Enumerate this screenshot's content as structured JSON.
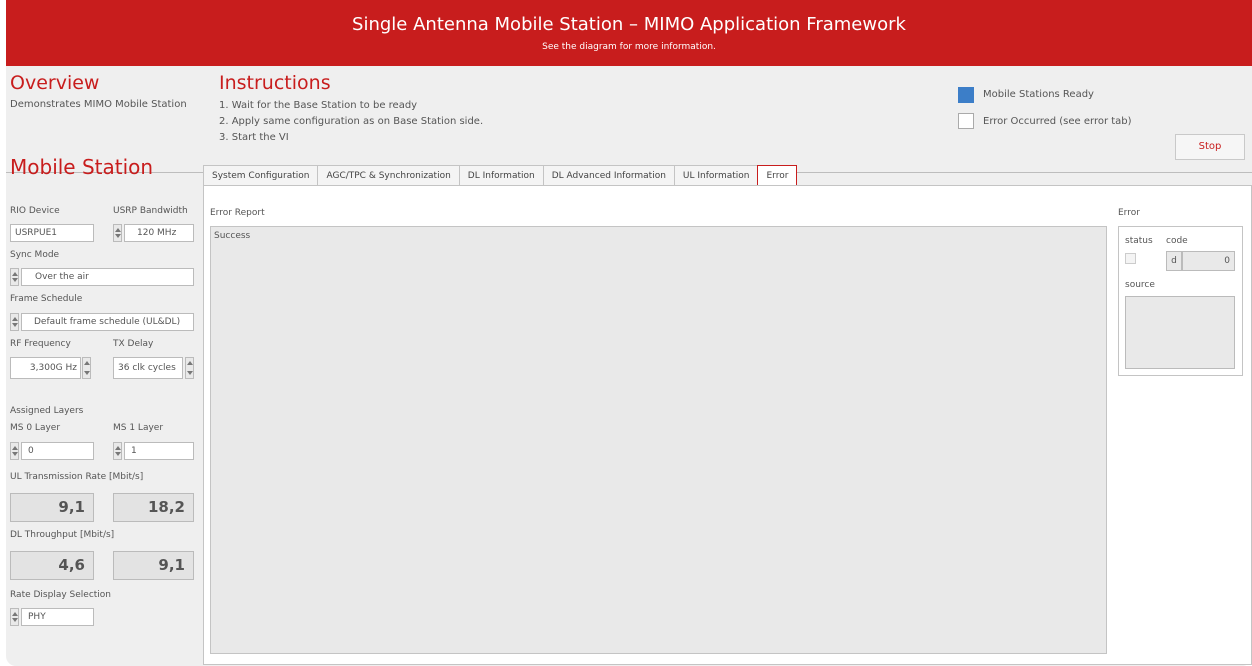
{
  "header": {
    "title": "Single Antenna Mobile Station – MIMO Application Framework",
    "subtitle": "See the diagram for more information."
  },
  "overview": {
    "title": "Overview",
    "description": "Demonstrates MIMO Mobile Station"
  },
  "instructions": {
    "title": "Instructions",
    "steps": [
      "1. Wait for the Base Station to be ready",
      "2. Apply same configuration as on Base Station side.",
      "3. Start the VI"
    ]
  },
  "status": {
    "mobile_ready_label": "Mobile Stations Ready",
    "mobile_ready_checked": true,
    "error_label": "Error Occurred (see error tab)",
    "error_checked": false
  },
  "stop_label": "Stop",
  "colors": {
    "brand_red": "#c81d1d",
    "led_blue": "#3c7ec8"
  },
  "mobile_station": {
    "title": "Mobile Station",
    "rio_device_label": "RIO Device",
    "rio_device_value": "USRPUE1",
    "usrp_bw_label": "USRP Bandwidth",
    "usrp_bw_value": "120 MHz",
    "sync_mode_label": "Sync Mode",
    "sync_mode_value": "Over the air",
    "frame_schedule_label": "Frame Schedule",
    "frame_schedule_value": "Default frame schedule (UL&DL)",
    "rf_freq_label": "RF Frequency",
    "rf_freq_value": "3,300G Hz",
    "tx_delay_label": "TX Delay",
    "tx_delay_value": "36 clk cycles",
    "assigned_layers_label": "Assigned Layers",
    "ms0_layer_label": "MS 0 Layer",
    "ms0_layer_value": "0",
    "ms1_layer_label": "MS 1 Layer",
    "ms1_layer_value": "1",
    "ul_rate_label": "UL Transmission Rate [Mbit/s]",
    "ul_rate_values": [
      "9,1",
      "18,2"
    ],
    "dl_throughput_label": "DL Throughput [Mbit/s]",
    "dl_throughput_values": [
      "4,6",
      "9,1"
    ],
    "rate_display_label": "Rate Display Selection",
    "rate_display_value": "PHY"
  },
  "tabs": [
    {
      "label": "System Configuration",
      "active": false
    },
    {
      "label": "AGC/TPC & Synchronization",
      "active": false
    },
    {
      "label": "DL Information",
      "active": false
    },
    {
      "label": "DL Advanced Information",
      "active": false
    },
    {
      "label": "UL Information",
      "active": false
    },
    {
      "label": "Error",
      "active": true
    }
  ],
  "error_tab": {
    "report_label": "Error Report",
    "report_text": "Success",
    "error_label": "Error",
    "status_label": "status",
    "code_label": "code",
    "code_prefix": "d",
    "code_value": "0",
    "source_label": "source"
  }
}
